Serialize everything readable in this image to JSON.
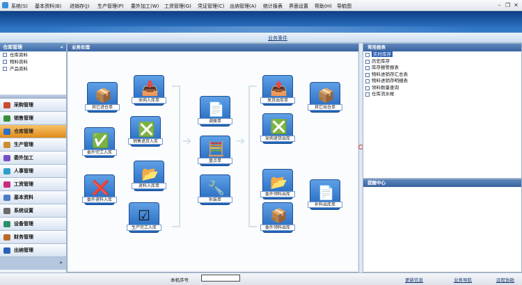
{
  "menu": [
    {
      "name": "menu-system",
      "label": "系统(S)"
    },
    {
      "name": "menu-basic-data",
      "label": "基本资料(B)"
    },
    {
      "name": "menu-purchase",
      "label": "进销存(J)"
    },
    {
      "name": "menu-production",
      "label": "生产管理(P)"
    },
    {
      "name": "menu-outsourcing",
      "label": "委外加工(W)"
    },
    {
      "name": "menu-wage",
      "label": "工资管理(G)"
    },
    {
      "name": "menu-certificate",
      "label": "凭证管理(C)"
    },
    {
      "name": "menu-cashier",
      "label": "出纳管理(A)"
    },
    {
      "name": "menu-reports",
      "label": "统计报表"
    },
    {
      "name": "menu-interface",
      "label": "界面设置"
    },
    {
      "name": "menu-help",
      "label": "帮助(H)"
    },
    {
      "name": "menu-navigator",
      "label": "导航图"
    }
  ],
  "stripe_title": "业务事件",
  "sidebar": {
    "title": "仓库管理",
    "collapse": "«",
    "tree": [
      "仓库资料",
      "物料资料",
      "产品资料"
    ],
    "modules": [
      {
        "label": "采购管理",
        "color": "#c94d2d"
      },
      {
        "label": "销售管理",
        "color": "#3a8f3a"
      },
      {
        "label": "仓库管理",
        "color": "#2d6ec9",
        "active": true
      },
      {
        "label": "生产管理",
        "color": "#c9902d"
      },
      {
        "label": "委外加工",
        "color": "#7a4dc9"
      },
      {
        "label": "人事管理",
        "color": "#2d9fc9"
      },
      {
        "label": "工资管理",
        "color": "#c92d7a"
      },
      {
        "label": "基本资料",
        "color": "#4d7ac9"
      },
      {
        "label": "系统设置",
        "color": "#6a6a6a"
      },
      {
        "label": "设备管理",
        "color": "#2d8f6a"
      },
      {
        "label": "财务管理",
        "color": "#b86a2d"
      },
      {
        "label": "出纳管理",
        "color": "#2d5fb8"
      }
    ],
    "footer_icon": "»"
  },
  "main": {
    "title": "业务处理",
    "nodes": [
      {
        "name": "purchase-in-node",
        "label": "其它进仓单",
        "glyph": "📦"
      },
      {
        "name": "purchase-receipt-node",
        "label": "采购入库单",
        "glyph": "📥"
      },
      {
        "name": "sales-return-node",
        "label": "销售退货入库",
        "glyph": "❎"
      },
      {
        "name": "production-in-node",
        "label": "委外完工入库",
        "glyph": "✅"
      },
      {
        "name": "return-material-node",
        "label": "委外退料入库",
        "glyph": "❌"
      },
      {
        "name": "material-return-node",
        "label": "退料入库单",
        "glyph": "📂"
      },
      {
        "name": "finished-in-node",
        "label": "生产完工入库",
        "glyph": "☑"
      },
      {
        "name": "transfer-node",
        "label": "调拨单",
        "glyph": "📄"
      },
      {
        "name": "stocktake-node",
        "label": "盘点单",
        "glyph": "🧮"
      },
      {
        "name": "assembly-node",
        "label": "拆装单",
        "glyph": "🔧"
      },
      {
        "name": "sales-out-node",
        "label": "发货出库单",
        "glyph": "📤"
      },
      {
        "name": "other-out-node",
        "label": "其它出仓单",
        "glyph": "📦"
      },
      {
        "name": "purchase-return-node",
        "label": "采购退货出库",
        "glyph": "❎"
      },
      {
        "name": "outsource-material-node",
        "label": "委外领料出库",
        "glyph": "📂"
      },
      {
        "name": "supplement-node",
        "label": "补料出库单",
        "glyph": "📄"
      },
      {
        "name": "outsource-out-node",
        "label": "委外领料出库",
        "glyph": "📦"
      }
    ]
  },
  "report": {
    "title": "常用报表",
    "items": [
      "实时库存",
      "历史库存",
      "库存报警报表",
      "物料进销存汇总表",
      "物料进销存明细表",
      "领料数量查询",
      "仓库流水帐"
    ]
  },
  "tips": {
    "title": "提醒中心"
  },
  "status": {
    "label": "本机序号",
    "links": [
      "更新信息",
      "业务导航",
      "远程协助"
    ]
  }
}
